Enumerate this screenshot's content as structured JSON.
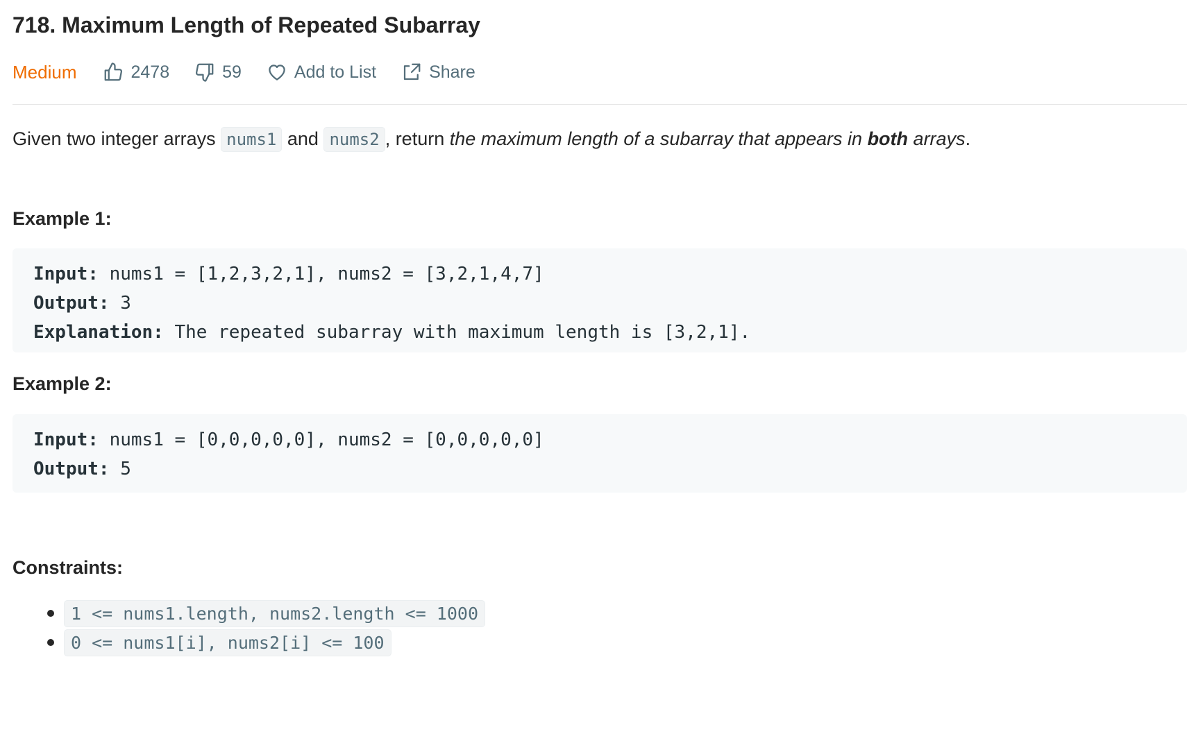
{
  "problem": {
    "title": "718. Maximum Length of Repeated Subarray",
    "difficulty": "Medium",
    "likes": "2478",
    "dislikes": "59",
    "add_to_list": "Add to List",
    "share": "Share"
  },
  "description": {
    "part1": "Given two integer arrays ",
    "code1": "nums1",
    "part2": " and ",
    "code2": "nums2",
    "part3": ", return ",
    "em1": "the maximum length of a subarray that appears in ",
    "strong": "both",
    "em2": " arrays",
    "end": "."
  },
  "examples": [
    {
      "heading": "Example 1:",
      "input_label": "Input:",
      "input": " nums1 = [1,2,3,2,1], nums2 = [3,2,1,4,7]",
      "output_label": "Output:",
      "output": " 3",
      "explanation_label": "Explanation:",
      "explanation": " The repeated subarray with maximum length is [3,2,1]."
    },
    {
      "heading": "Example 2:",
      "input_label": "Input:",
      "input": " nums1 = [0,0,0,0,0], nums2 = [0,0,0,0,0]",
      "output_label": "Output:",
      "output": " 5"
    }
  ],
  "constraints": {
    "heading": "Constraints:",
    "items": [
      "1 <= nums1.length, nums2.length <= 1000",
      "0 <= nums1[i], nums2[i] <= 100"
    ]
  },
  "colors": {
    "difficulty": "#ef6c00",
    "meta_text": "#546e7a",
    "code_bg": "#f7f9fa"
  },
  "icons": {
    "like": "thumbs-up-icon",
    "dislike": "thumbs-down-icon",
    "add_to_list": "heart-icon",
    "share": "share-icon"
  }
}
